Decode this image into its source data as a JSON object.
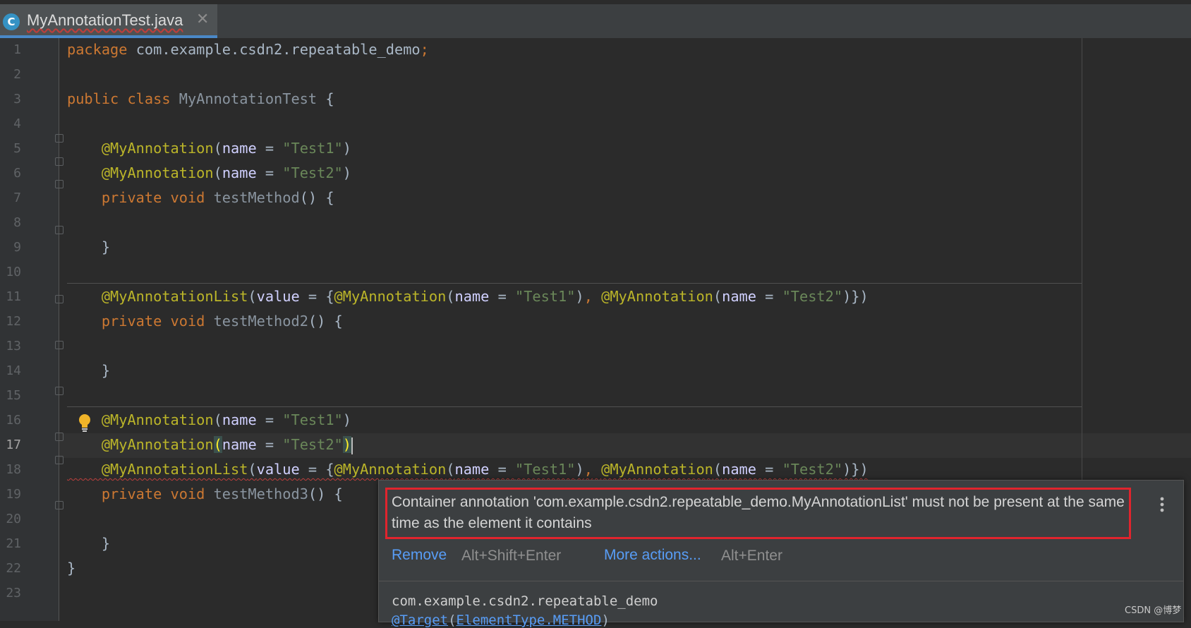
{
  "tab": {
    "icon_letter": "C",
    "title": "MyAnnotationTest.java",
    "close": "✕"
  },
  "line_numbers": [
    "1",
    "2",
    "3",
    "4",
    "5",
    "6",
    "7",
    "8",
    "9",
    "10",
    "11",
    "12",
    "13",
    "14",
    "15",
    "16",
    "17",
    "18",
    "19",
    "20",
    "21",
    "22",
    "23"
  ],
  "code": {
    "l1": {
      "kw": "package",
      "rest": " com.example.csdn2.repeatable_demo",
      "semi": ";"
    },
    "l3": {
      "kw": "public class",
      "cls": " MyAnnotationTest ",
      "brace": "{"
    },
    "l5": {
      "ann": "@MyAnnotation",
      "open": "(",
      "param": "name",
      "eq": " = ",
      "str": "\"Test1\"",
      "close": ")"
    },
    "l6": {
      "ann": "@MyAnnotation",
      "open": "(",
      "param": "name",
      "eq": " = ",
      "str": "\"Test2\"",
      "close": ")"
    },
    "l7": {
      "kw": "private void",
      "fn": " testMethod",
      "rest": "() {"
    },
    "l9": {
      "text": "}"
    },
    "l11": {
      "ann": "@MyAnnotationList",
      "p1": "(",
      "param1": "value",
      "p2": " = {",
      "ann2": "@MyAnnotation",
      "p3": "(",
      "param2": "name",
      "p4": " = ",
      "str1": "\"Test1\"",
      "p5": ")",
      "comma": ",",
      "sp": " ",
      "ann3": "@MyAnnotation",
      "p6": "(",
      "param3": "name",
      "p7": " = ",
      "str2": "\"Test2\"",
      "p8": ")})"
    },
    "l12": {
      "kw": "private void",
      "fn": " testMethod2",
      "rest": "() {"
    },
    "l14": {
      "text": "}"
    },
    "l16": {
      "ann": "@MyAnnotation",
      "open": "(",
      "param": "name",
      "eq": " = ",
      "str": "\"Test1\"",
      "close": ")"
    },
    "l17": {
      "ann": "@MyAnnotation",
      "open": "(",
      "param": "name",
      "eq": " = ",
      "str": "\"Test2\"",
      "close": ")"
    },
    "l18": {
      "ann": "@MyAnnotationList",
      "p1": "(",
      "param1": "value",
      "p2": " = {",
      "ann2": "@MyAnnotation",
      "p3": "(",
      "param2": "name",
      "p4": " = ",
      "str1": "\"Test1\"",
      "p5": ")",
      "comma": ",",
      "sp": " ",
      "ann3": "@MyAnnotation",
      "p6": "(",
      "param3": "name",
      "p7": " = ",
      "str2": "\"Test2\"",
      "p8": ")})"
    },
    "l19": {
      "kw": "private void",
      "fn": " testMethod3",
      "rest": "() {"
    },
    "l21": {
      "text": "}"
    },
    "l22": {
      "text": "}"
    }
  },
  "popup": {
    "message": "Container annotation 'com.example.csdn2.repeatable_demo.MyAnnotationList' must not be present at the same time as the element it contains",
    "action1_label": "Remove",
    "action1_shortcut": "Alt+Shift+Enter",
    "action2_label": "More actions...",
    "action2_shortcut": "Alt+Enter",
    "doc_package": "com.example.csdn2.repeatable_demo",
    "doc_target_annotation": "@Target",
    "doc_target_open": "(",
    "doc_target_value": "ElementType.METHOD",
    "doc_target_close": ")"
  },
  "watermark": "CSDN @博梦",
  "colors": {
    "keyword": "#cc7832",
    "annotation": "#bbb529",
    "string": "#6a8759",
    "error_box": "#e0242d",
    "link": "#589df6"
  }
}
